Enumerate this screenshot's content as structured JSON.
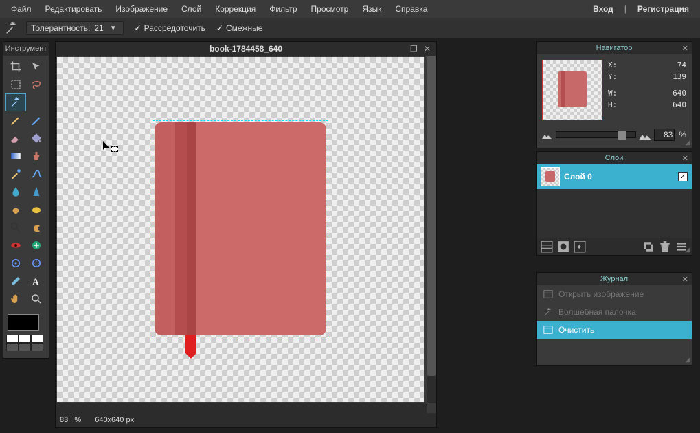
{
  "menu": {
    "items": [
      "Файл",
      "Редактировать",
      "Изображение",
      "Слой",
      "Коррекция",
      "Фильтр",
      "Просмотр",
      "Язык",
      "Справка"
    ],
    "login": "Вход",
    "register": "Регистрация"
  },
  "options": {
    "tolerance_label": "Толерантность:",
    "tolerance_value": "21",
    "anti_alias_label": "Рассредоточить",
    "contiguous_label": "Смежные"
  },
  "tools_panel_title": "Инструмент",
  "canvas": {
    "title": "book-1784458_640",
    "zoom": "83",
    "zoom_unit": "%",
    "dimensions": "640x640 px"
  },
  "navigator": {
    "title": "Навигатор",
    "x_label": "X:",
    "y_label": "Y:",
    "w_label": "W:",
    "h_label": "H:",
    "x": "74",
    "y": "139",
    "w": "640",
    "h": "640",
    "zoom": "83",
    "zoom_unit": "%"
  },
  "layers": {
    "title": "Слои",
    "layer0": "Слой 0"
  },
  "history": {
    "title": "Журнал",
    "items": [
      "Открыть изображение",
      "Волшебная палочка",
      "Очистить"
    ]
  },
  "palette_colors": [
    "#ffffff",
    "#ffffff",
    "#ffffff",
    "#555555",
    "#555555",
    "#555555"
  ]
}
